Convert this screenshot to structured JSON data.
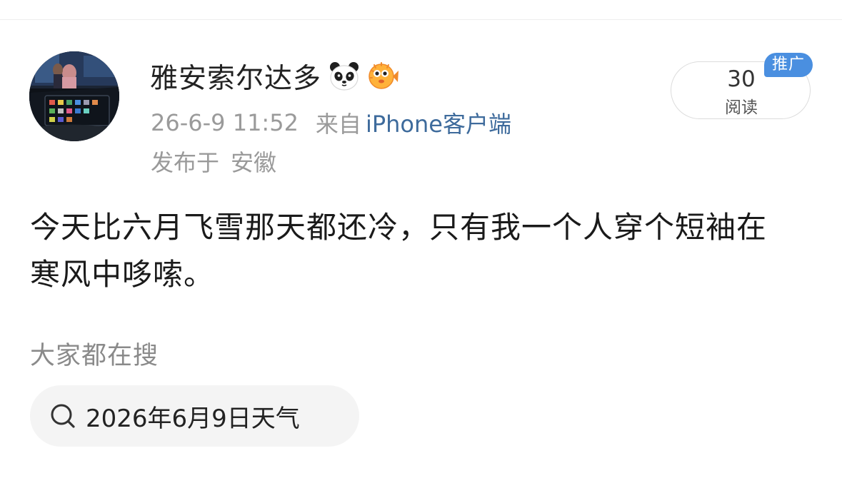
{
  "post": {
    "author": {
      "name": "雅安索尔达多",
      "badges": [
        "panda-icon",
        "pufferfish-icon"
      ]
    },
    "timestamp": "26-6-9 11:52",
    "source_prefix": "来自",
    "source": "iPhone客户端",
    "location_prefix": "发布于",
    "location": "安徽",
    "read_count": "30",
    "read_label": "阅读",
    "promo_tag": "推广",
    "text": "今天比六月飞雪那天都还冷，只有我一个人穿个短袖在寒风中哆嗦。"
  },
  "search": {
    "heading": "大家都在搜",
    "suggestion": "2026年6月9日天气",
    "icon": "search-icon"
  },
  "colors": {
    "link": "#3e6b9c",
    "muted_text": "#9a9a9a",
    "promo_bg": "#4a8fe0",
    "chip_bg": "#f4f4f4"
  }
}
